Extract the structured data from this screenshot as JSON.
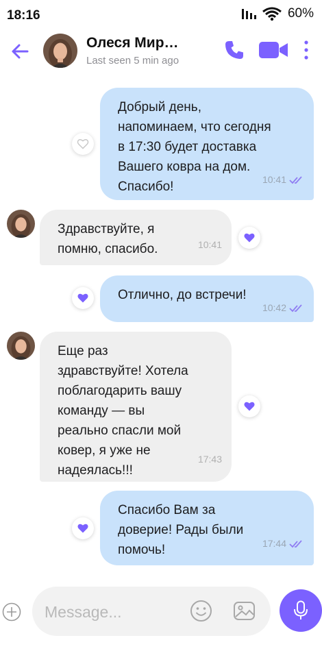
{
  "status_bar": {
    "time": "18:16",
    "battery": "60%",
    "icons": [
      "signal-icon",
      "wifi-icon"
    ]
  },
  "header": {
    "contact_name": "Олеся Мир…",
    "last_seen": "Last seen 5 min ago",
    "icons": [
      "back-arrow-icon",
      "phone-icon",
      "video-camera-icon",
      "more-vertical-icon"
    ],
    "accent_color": "#7b61ff"
  },
  "messages": [
    {
      "direction": "out",
      "text": "Добрый день,\nнапоминаем, что сегодня\nв 17:30 будет доставка\nВашего ковра на дом.\nСпасибо!",
      "time": "10:41",
      "liked": false
    },
    {
      "direction": "in",
      "text": "Здравствуйте, я\nпомню, спасибо.",
      "time": "10:41",
      "liked": true
    },
    {
      "direction": "out",
      "text": "Отлично, до встречи!",
      "time": "10:42",
      "liked": true
    },
    {
      "direction": "in",
      "text": "Еще раз\nздравствуйте! Хотела\nпоблагодарить вашу\nкоманду — вы\nреально спасли мой\nковер, я уже не\nнадеялась!!!",
      "time": "17:43",
      "liked": true
    },
    {
      "direction": "out",
      "text": "Спасибо Вам за\nдоверие! Рады были\nпомочь!",
      "time": "17:44",
      "liked": true
    }
  ],
  "input": {
    "placeholder": "Message...",
    "icons": [
      "plus-icon",
      "sticker-icon",
      "gallery-icon",
      "microphone-icon"
    ]
  },
  "colors": {
    "outgoing_bubble": "#c9e2fb",
    "incoming_bubble": "#efefef",
    "accent": "#7b61ff"
  }
}
